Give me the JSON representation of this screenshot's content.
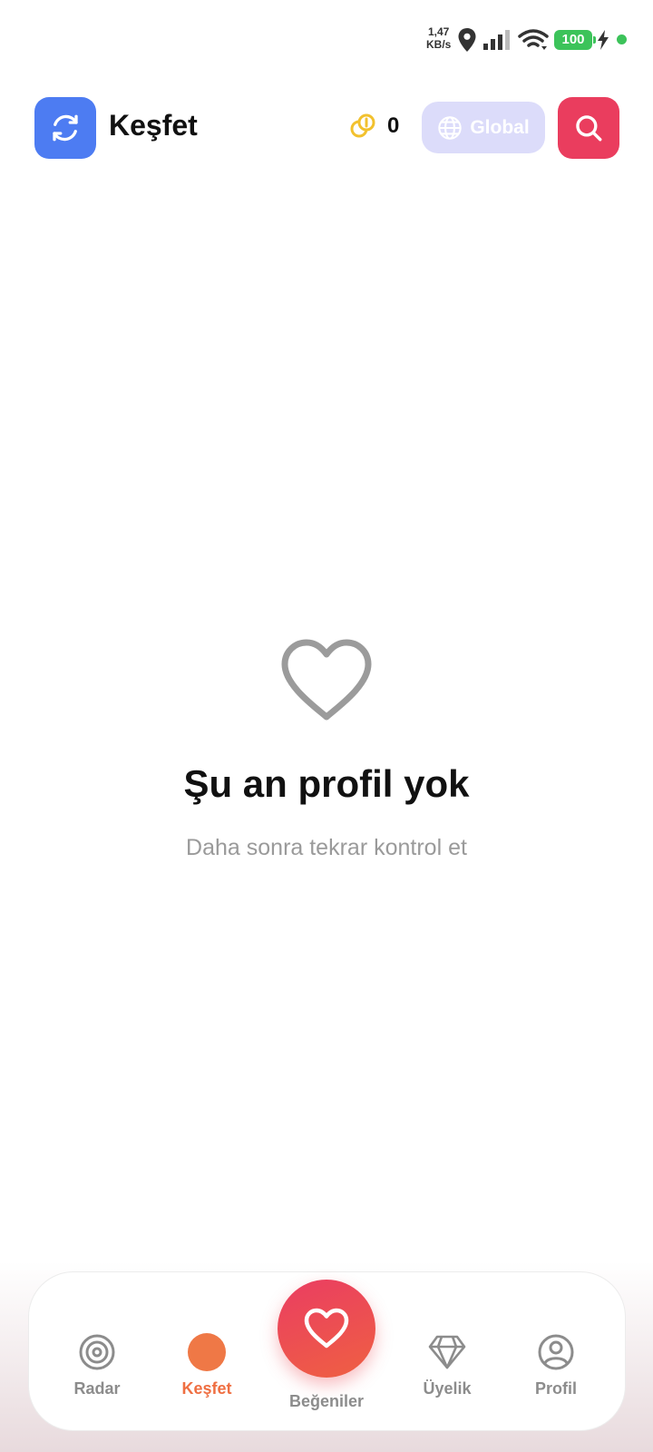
{
  "status_bar": {
    "net_speed_value": "1,47",
    "net_speed_unit": "KB/s",
    "battery": "100"
  },
  "header": {
    "title": "Keşfet",
    "coins": "0",
    "region_label": "Global"
  },
  "empty_state": {
    "title": "Şu an profil yok",
    "subtitle": "Daha sonra tekrar kontrol et"
  },
  "bottom_nav": {
    "items": [
      {
        "label": "Radar",
        "icon": "radar-icon",
        "active": false
      },
      {
        "label": "Keşfet",
        "icon": "dot-icon",
        "active": true
      },
      {
        "label": "Beğeniler",
        "icon": "heart-icon",
        "active": false
      },
      {
        "label": "Üyelik",
        "icon": "diamond-icon",
        "active": false
      },
      {
        "label": "Profil",
        "icon": "user-icon",
        "active": false
      }
    ]
  },
  "colors": {
    "app_icon": "#4d7cf2",
    "search_button": "#ea3d5e",
    "region_button": "#dcdcfa",
    "active_nav": "#ef6f42",
    "coin": "#f2c12e",
    "battery": "#3cc35a"
  }
}
